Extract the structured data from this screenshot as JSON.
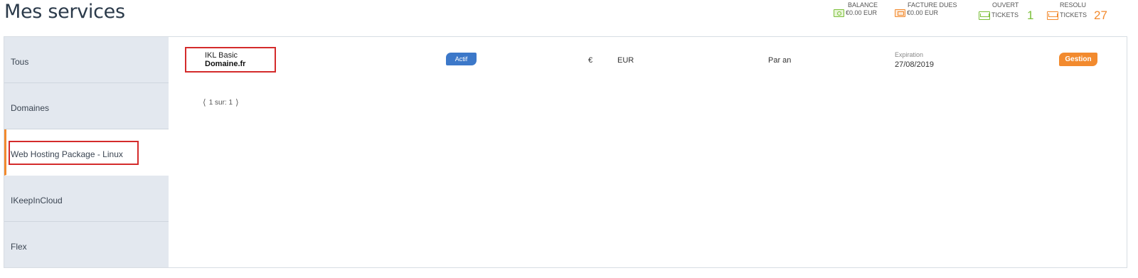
{
  "page": {
    "title": "Mes services"
  },
  "stats": {
    "balance": {
      "label": "BALANCE",
      "value": "€0.00 EUR",
      "icon": "money-icon"
    },
    "invoices": {
      "label": "FACTURE DUES",
      "value": "€0.00 EUR",
      "icon": "invoice-icon"
    },
    "open_tickets": {
      "label": "OUVERT",
      "sublabel": "TICKETS",
      "count": "1",
      "icon": "inbox-icon",
      "color": "#7bbf3a"
    },
    "resolved_tickets": {
      "label": "RESOLU",
      "sublabel": "TICKETS",
      "count": "27",
      "icon": "inbox-icon",
      "color": "#f28a2e"
    }
  },
  "sidebar": {
    "items": [
      {
        "label": "Tous"
      },
      {
        "label": "Domaines"
      },
      {
        "label": "Web Hosting Package - Linux",
        "active": true
      },
      {
        "label": "IKeepInCloud"
      },
      {
        "label": "Flex"
      }
    ],
    "accent": "#f28a2e"
  },
  "services": [
    {
      "name": "IKL Basic",
      "domain": "Domaine.fr",
      "status": "Actif",
      "currency_symbol": "€",
      "currency": "EUR",
      "billing_cycle": "Par an",
      "expiration_label": "Expiration",
      "expiration_date": "27/08/2019",
      "action_label": "Gestion"
    }
  ],
  "pager": {
    "text": "1 sur: 1"
  },
  "colors": {
    "status": "#3c78c9",
    "action": "#f28a2e",
    "highlight": "#d42b2b"
  }
}
